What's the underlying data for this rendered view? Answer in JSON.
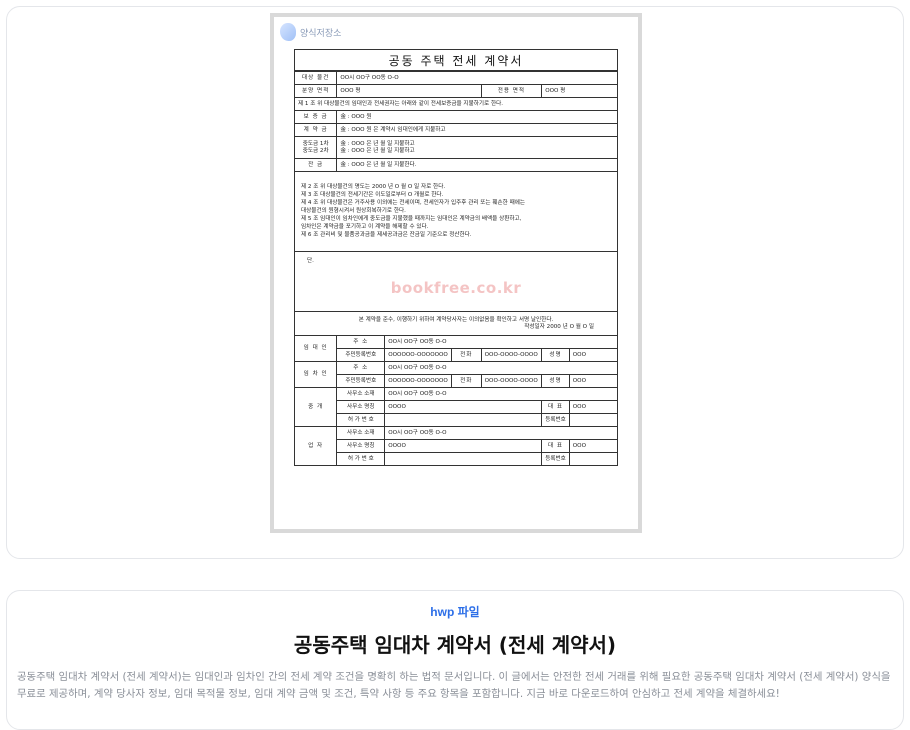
{
  "preview": {
    "logo_text": "양식저장소",
    "watermark": "bookfree.co.kr",
    "doc": {
      "title": "공동 주택 전세 계약서",
      "property_label": "대상 물건",
      "property_value": "OO시 OO구 OO동 O-O",
      "area_label": "분양 면적",
      "area_value": "OOO 평",
      "exclusive_label": "전용 면적",
      "exclusive_value": "OOO 평",
      "clause1": "제 1 조 위 대상물건의 임대인과 전세권자는 아래와 같이 전세보증금을 지불하기로 한다.",
      "deposit_label": "보 증 금",
      "deposit_value": "金 : OOO 원",
      "contract_label": "계 약 금",
      "contract_value": "金 :    OOO      원 은 계약시 임대인에게 지불하고",
      "mid1_label": "중도금 1차",
      "mid1_value": "金 :    OOO      은       년       월           일 지불하고",
      "mid2_label": "중도금 2차",
      "mid2_value": "金 :    OOO      은       년       월           일 지불하고",
      "balance_label": "잔 금",
      "balance_value": "金 :    OOO      은       년       월           일 지불한다.",
      "clauses": [
        "제 2 조  위 대상물건의 명도는 2000 년 O 월 O 일 자로 한다.",
        "제 3 조  대상물건의 전세기간은 이도일로부터  O 개월로 한다.",
        "제 4 조  위 대상물건은 거주사용 이외에는 전세이며, 전세인자가 입주후 관리 또는 훼손한 때에는",
        "            대상물건의 원형시켜서 원상회복하기로 한다.",
        "제 5 조  임대인이 임차인에게 중도금을 지불했을 때까지는 임대인은 계약금의 배액을 상환하고,",
        "            임차인은 계약금을 포기하고 이 계약을 해제할 수 있다.",
        "제 6 조  관리비 및 물품공과금을 제세공과금은 잔금일 기준으로 정산한다."
      ],
      "special_label": "단.",
      "confirm_text": "본 계약을 준수, 이행하기 위하여 계약당사자는 이의없음을 확인하고 서명 날인한다.",
      "date_text": "작성일자   2000  년  O  월   O  일",
      "lessor_label": "임 대 인",
      "lessee_label": "임 차 인",
      "address_label": "주         소",
      "address_value": "OO시 OO구 OO동 O-O",
      "id_label": "주민등록번호",
      "id_value": "OOOOOO-OOOOOOO",
      "phone_label": "전화",
      "phone_value": "OOO-OOOO-OOOO",
      "name_label": "성명",
      "name_value": "OOO",
      "agent_label_1": "중     개",
      "agent_label_2": "업     자",
      "office_addr_label": "사무소  소재",
      "office_addr_value": "OO시 OO구 OO동 O-O",
      "office_name_label": "사무소  명칭",
      "office_name_value": "OOOO",
      "rep_label": "대     표",
      "rep_value": "OOO",
      "license_label": "허 가  번 호",
      "reg_label": "등록번호"
    }
  },
  "info": {
    "tag": "hwp 파일",
    "title": "공동주택 임대차 계약서 (전세 계약서)",
    "description": "공동주택 임대차 계약서 (전세 계약서)는 임대인과 임차인 간의 전세 계약 조건을 명확히 하는 법적 문서입니다. 이 글에서는 안전한 전세 거래를 위해 필요한 공동주택 임대차 계약서 (전세 계약서) 양식을 무료로 제공하며, 계약 당사자 정보, 임대 목적물 정보, 임대 계약 금액 및 조건, 특약 사항 등 주요 항목을 포함합니다. 지금 바로 다운로드하여 안심하고 전세 계약을 체결하세요!"
  }
}
